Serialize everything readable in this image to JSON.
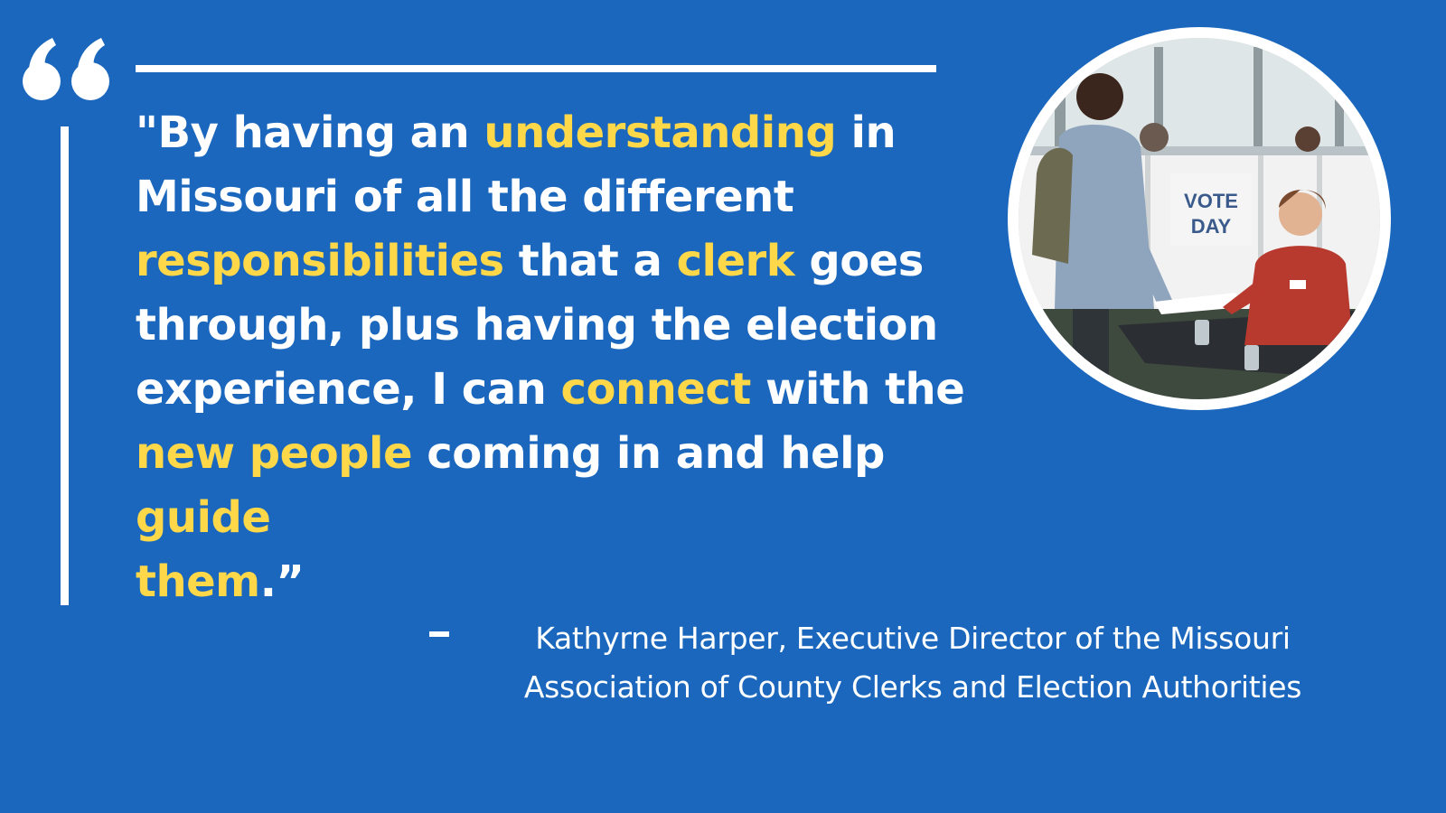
{
  "quote": {
    "l1a": "\"By having an ",
    "l1b": "understanding",
    "l1c": " in",
    "l2": "Missouri of all the different",
    "l3a": "responsibilities",
    "l3b": " that a ",
    "l3c": "clerk",
    "l3d": " goes",
    "l4": "through, plus having the election",
    "l5a": "experience, I can ",
    "l5b": "connect",
    "l5c": " with the",
    "l6a": "new people",
    "l6b": " coming in and help ",
    "l6c": "guide",
    "l7a": "them",
    "l7b": ".”"
  },
  "attribution": {
    "line1": "Kathyrne Harper, Executive Director of the Missouri",
    "line2": "Association of County Clerks and Election Authorities"
  },
  "photo": {
    "sign_line1": "VOTE",
    "sign_line2": "DAY"
  },
  "colors": {
    "background": "#1a67bd",
    "text": "#ffffff",
    "highlight": "#ffd84a"
  }
}
